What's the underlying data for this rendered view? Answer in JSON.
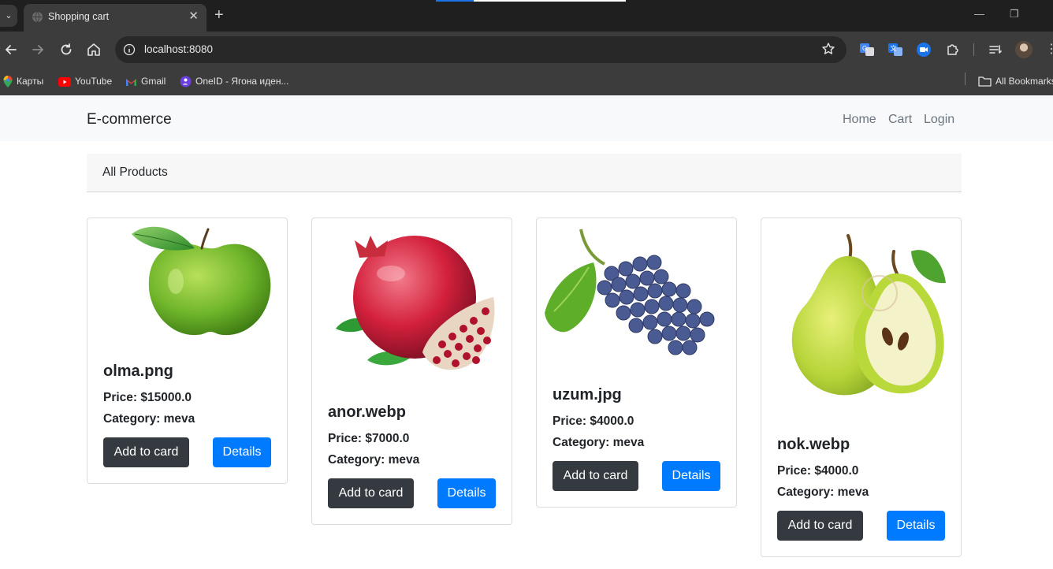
{
  "browser": {
    "tab_title": "Shopping cart",
    "tab_close": "✕",
    "new_tab": "+",
    "url": "localhost:8080",
    "bookmarks": [
      {
        "label": "Карты"
      },
      {
        "label": "YouTube"
      },
      {
        "label": "Gmail"
      },
      {
        "label": "OneID - Ягона иден..."
      }
    ],
    "all_bookmarks": "All Bookmarks"
  },
  "navbar": {
    "brand": "E-commerce",
    "links": [
      "Home",
      "Cart",
      "Login"
    ]
  },
  "section": {
    "title": "All Products"
  },
  "products": [
    {
      "name": "olma.png",
      "price": "Price: $15000.0",
      "category": "Category: meva",
      "image": "green-apple",
      "add_label": "Add to card",
      "details_label": "Details"
    },
    {
      "name": "anor.webp",
      "price": "Price: $7000.0",
      "category": "Category: meva",
      "image": "pomegranate",
      "add_label": "Add to card",
      "details_label": "Details"
    },
    {
      "name": "uzum.jpg",
      "price": "Price: $4000.0",
      "category": "Category: meva",
      "image": "grapes",
      "add_label": "Add to card",
      "details_label": "Details"
    },
    {
      "name": "nok.webp",
      "price": "Price: $4000.0",
      "category": "Category: meva",
      "image": "pear",
      "add_label": "Add to card",
      "details_label": "Details"
    }
  ],
  "colors": {
    "primary": "#007bff",
    "dark": "#343a40",
    "navbar_bg": "#f8f9fa",
    "chrome_bg": "#3c3c3c"
  }
}
